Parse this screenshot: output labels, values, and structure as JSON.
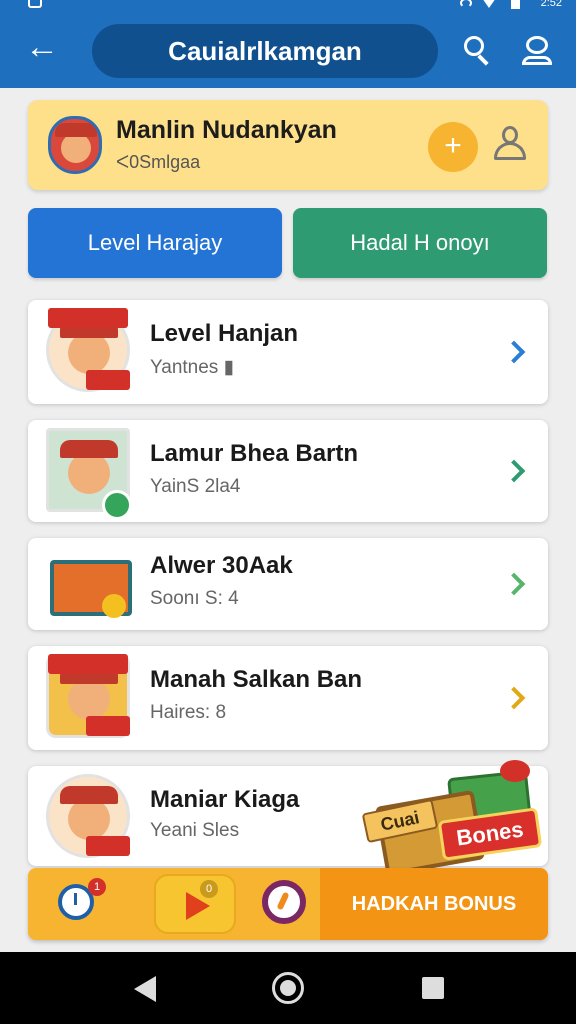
{
  "status_bar": {
    "time": "2:52"
  },
  "app_bar": {
    "title": "Cauialrlkamgan",
    "back_icon": "arrow-left-icon",
    "search_icon": "search-icon",
    "account_icon": "account-icon",
    "color": "#1f6fbf"
  },
  "profile": {
    "name": "Manlin Nudankyan",
    "subtitle": "ᐸ0Smlgaa",
    "add_label": "+",
    "card_color": "#ffe08a"
  },
  "tabs": [
    {
      "label": "Level Harajay",
      "color": "#2374d4"
    },
    {
      "label": "Hadal H onoyı",
      "color": "#2f9b72"
    }
  ],
  "items": [
    {
      "title": "Level Hanjan",
      "subtitle": "Yantnes ▮",
      "chevron_color": "#2a7fd4"
    },
    {
      "title": "Lamur Bhea Bartn",
      "subtitle": "YainS 2la4",
      "chevron_color": "#2f9b72"
    },
    {
      "title": "Alwer 30Aak",
      "subtitle": "Soonı S: 4",
      "chevron_color": "#5ab56c"
    },
    {
      "title": "Manah Salkan Ban",
      "subtitle": "Haires: 8",
      "chevron_color": "#e2a816"
    },
    {
      "title": "Maniar Kiaga",
      "subtitle": "Yeani Sles"
    }
  ],
  "promo": {
    "label_top": "Cuai",
    "label_main": "Bones"
  },
  "bottom_bar": {
    "clock_badge": "1",
    "play_badge": "0",
    "bonus_label": "HADKAH BONUS"
  }
}
